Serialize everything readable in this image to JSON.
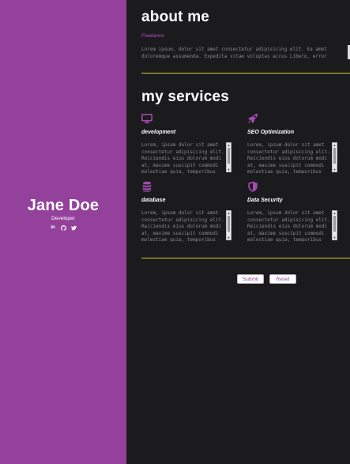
{
  "profile": {
    "name": "Jane Doe",
    "role": "Developer",
    "socials": [
      {
        "icon": "linkedin-icon",
        "label": "in"
      },
      {
        "icon": "github-icon",
        "label": ""
      },
      {
        "icon": "twitter-icon",
        "label": ""
      }
    ]
  },
  "about": {
    "title": "about me",
    "subtitle": "Freelance",
    "text": "Lorem ipsum, dolor sit amet consectetur adipisicing elit. Ea amet doloremque assumenda. Expedita vitae voluptas accus Libero, error"
  },
  "services": {
    "title": "my services",
    "items": [
      {
        "icon": "monitor-icon",
        "name": "development",
        "text": "Lorem, ipsum dolor sit amet consectetur adipisicing elit. Reiciendis eius dolorum modi at, maxime suscipit commodi molestiae quia, temporibus"
      },
      {
        "icon": "rocket-icon",
        "name": "SEO Optimization",
        "text": "Lorem, ipsum dolor sit amet consectetur adipisicing elit. Reiciendis eius dolorum modi at, maxime suscipit commodi molestiae quia, temporibus"
      },
      {
        "icon": "database-icon",
        "name": "database",
        "text": "Lorem, ipsum dolor sit amet consectetur adipisicing elit. Reiciendis eius dolorum modi at, maxime suscipit commodi molestiae quia, temporibus"
      },
      {
        "icon": "shield-icon",
        "name": "Data Security",
        "text": "Lorem, ipsum dolor sit amet consectetur adipisicing elit. Reiciendis eius dolorum modi at, maxime suscipit commodi molestiae quia, temporibus"
      }
    ]
  },
  "form": {
    "submit_label": "Submit",
    "reset_label": "Reset"
  },
  "colors": {
    "sidebar": "#93419b",
    "background": "#1b1b1d",
    "accent": "#a34cb0",
    "divider": "#d8c93a"
  }
}
